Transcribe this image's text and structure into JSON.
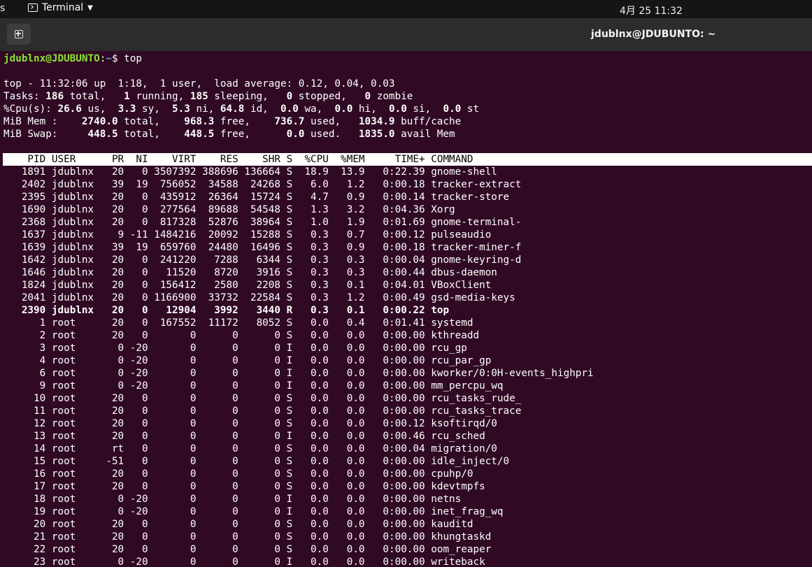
{
  "topbar": {
    "activities_fragment": "s",
    "app_menu_label": "Terminal",
    "clock": "4月 25  11:32"
  },
  "window": {
    "title": "jdublnx@JDUBUNTO: ~"
  },
  "terminal": {
    "prompt_user": "jdublnx@JDUBUNTO",
    "prompt_sep": ":",
    "prompt_path": "~",
    "prompt_symbol": "$ ",
    "command": "top",
    "summary": {
      "line1": "top - 11:32:06 up  1:18,  1 user,  load average: 0.12, 0.04, 0.03",
      "tasks": {
        "label": "Tasks: ",
        "total": "186",
        "running": "1",
        "sleeping": "185",
        "stopped": "0",
        "zombie": "0"
      },
      "cpu": {
        "label": "%Cpu(s): ",
        "us": "26.6",
        "sy": "3.3",
        "ni": "5.3",
        "id": "64.8",
        "wa": "0.0",
        "hi": "0.0",
        "si": "0.0",
        "st": "0.0"
      },
      "mem": {
        "label": "MiB Mem :",
        "total": "2740.0",
        "free": "968.3",
        "used": "736.7",
        "buff_cache": "1034.9"
      },
      "swap": {
        "label": "MiB Swap:",
        "total": "448.5",
        "free": "448.5",
        "used": "0.0",
        "avail": "1835.0"
      }
    },
    "columns": [
      "PID",
      "USER",
      "PR",
      "NI",
      "VIRT",
      "RES",
      "SHR",
      "S",
      "%CPU",
      "%MEM",
      "TIME+",
      "COMMAND"
    ],
    "processes": [
      {
        "pid": "1891",
        "user": "jdublnx",
        "pr": "20",
        "ni": "0",
        "virt": "3507392",
        "res": "388696",
        "shr": "136664",
        "s": "S",
        "cpu": "18.9",
        "mem": "13.9",
        "time": "0:22.39",
        "cmd": "gnome-shell"
      },
      {
        "pid": "2402",
        "user": "jdublnx",
        "pr": "39",
        "ni": "19",
        "virt": "756052",
        "res": "34588",
        "shr": "24268",
        "s": "S",
        "cpu": "6.0",
        "mem": "1.2",
        "time": "0:00.18",
        "cmd": "tracker-extract"
      },
      {
        "pid": "2395",
        "user": "jdublnx",
        "pr": "20",
        "ni": "0",
        "virt": "435912",
        "res": "26364",
        "shr": "15724",
        "s": "S",
        "cpu": "4.7",
        "mem": "0.9",
        "time": "0:00.14",
        "cmd": "tracker-store"
      },
      {
        "pid": "1690",
        "user": "jdublnx",
        "pr": "20",
        "ni": "0",
        "virt": "277564",
        "res": "89688",
        "shr": "54548",
        "s": "S",
        "cpu": "1.3",
        "mem": "3.2",
        "time": "0:04.36",
        "cmd": "Xorg"
      },
      {
        "pid": "2368",
        "user": "jdublnx",
        "pr": "20",
        "ni": "0",
        "virt": "817328",
        "res": "52876",
        "shr": "38964",
        "s": "S",
        "cpu": "1.0",
        "mem": "1.9",
        "time": "0:01.69",
        "cmd": "gnome-terminal-"
      },
      {
        "pid": "1637",
        "user": "jdublnx",
        "pr": "9",
        "ni": "-11",
        "virt": "1484216",
        "res": "20092",
        "shr": "15288",
        "s": "S",
        "cpu": "0.3",
        "mem": "0.7",
        "time": "0:00.12",
        "cmd": "pulseaudio"
      },
      {
        "pid": "1639",
        "user": "jdublnx",
        "pr": "39",
        "ni": "19",
        "virt": "659760",
        "res": "24480",
        "shr": "16496",
        "s": "S",
        "cpu": "0.3",
        "mem": "0.9",
        "time": "0:00.18",
        "cmd": "tracker-miner-f"
      },
      {
        "pid": "1642",
        "user": "jdublnx",
        "pr": "20",
        "ni": "0",
        "virt": "241220",
        "res": "7288",
        "shr": "6344",
        "s": "S",
        "cpu": "0.3",
        "mem": "0.3",
        "time": "0:00.04",
        "cmd": "gnome-keyring-d"
      },
      {
        "pid": "1646",
        "user": "jdublnx",
        "pr": "20",
        "ni": "0",
        "virt": "11520",
        "res": "8720",
        "shr": "3916",
        "s": "S",
        "cpu": "0.3",
        "mem": "0.3",
        "time": "0:00.44",
        "cmd": "dbus-daemon"
      },
      {
        "pid": "1824",
        "user": "jdublnx",
        "pr": "20",
        "ni": "0",
        "virt": "156412",
        "res": "2580",
        "shr": "2208",
        "s": "S",
        "cpu": "0.3",
        "mem": "0.1",
        "time": "0:04.01",
        "cmd": "VBoxClient"
      },
      {
        "pid": "2041",
        "user": "jdublnx",
        "pr": "20",
        "ni": "0",
        "virt": "1166900",
        "res": "33732",
        "shr": "22584",
        "s": "S",
        "cpu": "0.3",
        "mem": "1.2",
        "time": "0:00.49",
        "cmd": "gsd-media-keys"
      },
      {
        "pid": "2390",
        "user": "jdublnx",
        "pr": "20",
        "ni": "0",
        "virt": "12904",
        "res": "3992",
        "shr": "3440",
        "s": "R",
        "cpu": "0.3",
        "mem": "0.1",
        "time": "0:00.22",
        "cmd": "top",
        "bold": true
      },
      {
        "pid": "1",
        "user": "root",
        "pr": "20",
        "ni": "0",
        "virt": "167552",
        "res": "11172",
        "shr": "8052",
        "s": "S",
        "cpu": "0.0",
        "mem": "0.4",
        "time": "0:01.41",
        "cmd": "systemd"
      },
      {
        "pid": "2",
        "user": "root",
        "pr": "20",
        "ni": "0",
        "virt": "0",
        "res": "0",
        "shr": "0",
        "s": "S",
        "cpu": "0.0",
        "mem": "0.0",
        "time": "0:00.00",
        "cmd": "kthreadd"
      },
      {
        "pid": "3",
        "user": "root",
        "pr": "0",
        "ni": "-20",
        "virt": "0",
        "res": "0",
        "shr": "0",
        "s": "I",
        "cpu": "0.0",
        "mem": "0.0",
        "time": "0:00.00",
        "cmd": "rcu_gp"
      },
      {
        "pid": "4",
        "user": "root",
        "pr": "0",
        "ni": "-20",
        "virt": "0",
        "res": "0",
        "shr": "0",
        "s": "I",
        "cpu": "0.0",
        "mem": "0.0",
        "time": "0:00.00",
        "cmd": "rcu_par_gp"
      },
      {
        "pid": "6",
        "user": "root",
        "pr": "0",
        "ni": "-20",
        "virt": "0",
        "res": "0",
        "shr": "0",
        "s": "I",
        "cpu": "0.0",
        "mem": "0.0",
        "time": "0:00.00",
        "cmd": "kworker/0:0H-events_highpri"
      },
      {
        "pid": "9",
        "user": "root",
        "pr": "0",
        "ni": "-20",
        "virt": "0",
        "res": "0",
        "shr": "0",
        "s": "I",
        "cpu": "0.0",
        "mem": "0.0",
        "time": "0:00.00",
        "cmd": "mm_percpu_wq"
      },
      {
        "pid": "10",
        "user": "root",
        "pr": "20",
        "ni": "0",
        "virt": "0",
        "res": "0",
        "shr": "0",
        "s": "S",
        "cpu": "0.0",
        "mem": "0.0",
        "time": "0:00.00",
        "cmd": "rcu_tasks_rude_"
      },
      {
        "pid": "11",
        "user": "root",
        "pr": "20",
        "ni": "0",
        "virt": "0",
        "res": "0",
        "shr": "0",
        "s": "S",
        "cpu": "0.0",
        "mem": "0.0",
        "time": "0:00.00",
        "cmd": "rcu_tasks_trace"
      },
      {
        "pid": "12",
        "user": "root",
        "pr": "20",
        "ni": "0",
        "virt": "0",
        "res": "0",
        "shr": "0",
        "s": "S",
        "cpu": "0.0",
        "mem": "0.0",
        "time": "0:00.12",
        "cmd": "ksoftirqd/0"
      },
      {
        "pid": "13",
        "user": "root",
        "pr": "20",
        "ni": "0",
        "virt": "0",
        "res": "0",
        "shr": "0",
        "s": "I",
        "cpu": "0.0",
        "mem": "0.0",
        "time": "0:00.46",
        "cmd": "rcu_sched"
      },
      {
        "pid": "14",
        "user": "root",
        "pr": "rt",
        "ni": "0",
        "virt": "0",
        "res": "0",
        "shr": "0",
        "s": "S",
        "cpu": "0.0",
        "mem": "0.0",
        "time": "0:00.04",
        "cmd": "migration/0"
      },
      {
        "pid": "15",
        "user": "root",
        "pr": "-51",
        "ni": "0",
        "virt": "0",
        "res": "0",
        "shr": "0",
        "s": "S",
        "cpu": "0.0",
        "mem": "0.0",
        "time": "0:00.00",
        "cmd": "idle_inject/0"
      },
      {
        "pid": "16",
        "user": "root",
        "pr": "20",
        "ni": "0",
        "virt": "0",
        "res": "0",
        "shr": "0",
        "s": "S",
        "cpu": "0.0",
        "mem": "0.0",
        "time": "0:00.00",
        "cmd": "cpuhp/0"
      },
      {
        "pid": "17",
        "user": "root",
        "pr": "20",
        "ni": "0",
        "virt": "0",
        "res": "0",
        "shr": "0",
        "s": "S",
        "cpu": "0.0",
        "mem": "0.0",
        "time": "0:00.00",
        "cmd": "kdevtmpfs"
      },
      {
        "pid": "18",
        "user": "root",
        "pr": "0",
        "ni": "-20",
        "virt": "0",
        "res": "0",
        "shr": "0",
        "s": "I",
        "cpu": "0.0",
        "mem": "0.0",
        "time": "0:00.00",
        "cmd": "netns"
      },
      {
        "pid": "19",
        "user": "root",
        "pr": "0",
        "ni": "-20",
        "virt": "0",
        "res": "0",
        "shr": "0",
        "s": "I",
        "cpu": "0.0",
        "mem": "0.0",
        "time": "0:00.00",
        "cmd": "inet_frag_wq"
      },
      {
        "pid": "20",
        "user": "root",
        "pr": "20",
        "ni": "0",
        "virt": "0",
        "res": "0",
        "shr": "0",
        "s": "S",
        "cpu": "0.0",
        "mem": "0.0",
        "time": "0:00.00",
        "cmd": "kauditd"
      },
      {
        "pid": "21",
        "user": "root",
        "pr": "20",
        "ni": "0",
        "virt": "0",
        "res": "0",
        "shr": "0",
        "s": "S",
        "cpu": "0.0",
        "mem": "0.0",
        "time": "0:00.00",
        "cmd": "khungtaskd"
      },
      {
        "pid": "22",
        "user": "root",
        "pr": "20",
        "ni": "0",
        "virt": "0",
        "res": "0",
        "shr": "0",
        "s": "S",
        "cpu": "0.0",
        "mem": "0.0",
        "time": "0:00.00",
        "cmd": "oom_reaper"
      },
      {
        "pid": "23",
        "user": "root",
        "pr": "0",
        "ni": "-20",
        "virt": "0",
        "res": "0",
        "shr": "0",
        "s": "I",
        "cpu": "0.0",
        "mem": "0.0",
        "time": "0:00.00",
        "cmd": "writeback"
      }
    ]
  },
  "colors": {
    "terminal_bg": "#300a24",
    "prompt_user": "#8ae234",
    "prompt_path": "#729fcf",
    "header_bg": "#ffffff"
  }
}
